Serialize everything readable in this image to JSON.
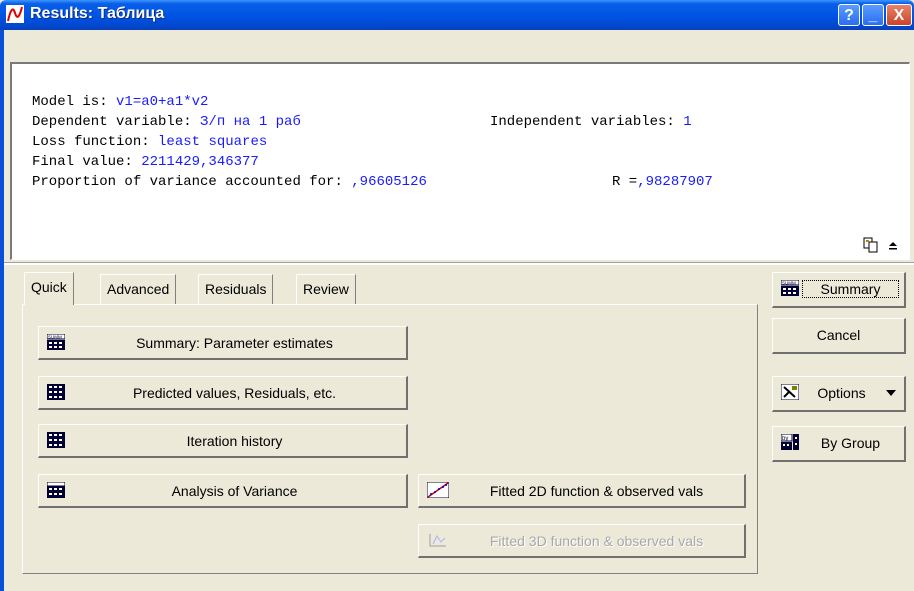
{
  "window": {
    "title": "Results: Таблица",
    "help_glyph": "?",
    "min_glyph": "_",
    "close_glyph": "X"
  },
  "output": {
    "model_label": "Model is: ",
    "model_value": "v1=a0+a1*v2",
    "dep_label": "Dependent variable: ",
    "dep_value": "З/п на 1 раб",
    "indep_label": "Independent variables: ",
    "indep_value": "1",
    "loss_label": "Loss function: ",
    "loss_value": "least squares",
    "final_label": "Final value: ",
    "final_value": "2211429,346377",
    "prop_label": "Proportion of variance accounted for: ",
    "prop_value": ",96605126",
    "r_label": "R =",
    "r_value": ",98287907"
  },
  "tabs": [
    "Quick",
    "Advanced",
    "Residuals",
    "Review"
  ],
  "quick": {
    "summary_btn": "Summary: Parameter estimates",
    "predicted_btn": "Predicted values, Residuals, etc.",
    "iteration_btn": "Iteration history",
    "anova_btn": "Analysis of Variance",
    "fitted2d_btn": "Fitted 2D function & observed vals",
    "fitted3d_btn": "Fitted 3D function & observed vals"
  },
  "side": {
    "summary": "Summary",
    "cancel": "Cancel",
    "options": "Options",
    "by_group": "By Group"
  },
  "colors": {
    "value_text": "#1a1aff",
    "titlebar": "#0055e5"
  }
}
